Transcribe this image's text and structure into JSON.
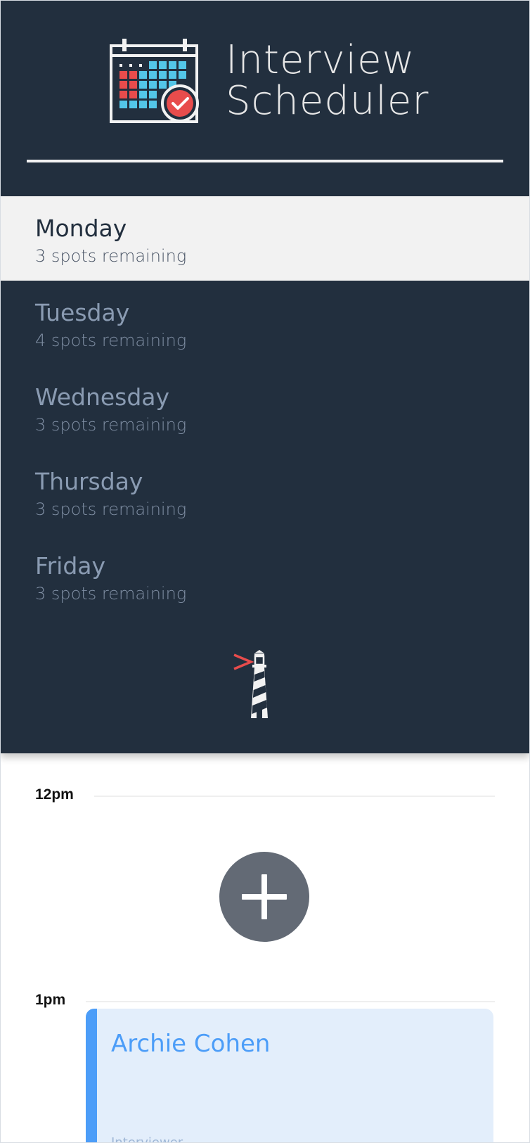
{
  "app": {
    "title_line1": "Interview",
    "title_line2": "Scheduler"
  },
  "icons": {
    "app_logo": "calendar-check-icon",
    "footer_logo": "lighthouse-icon"
  },
  "colors": {
    "sidebar_bg": "#222f3e",
    "selected_day_bg": "#f2f2f2",
    "accent_blue": "#4c9df8",
    "add_button": "#636a75"
  },
  "days": [
    {
      "name": "Monday",
      "spots": "3 spots remaining",
      "selected": true
    },
    {
      "name": "Tuesday",
      "spots": "4 spots remaining",
      "selected": false
    },
    {
      "name": "Wednesday",
      "spots": "3 spots remaining",
      "selected": false
    },
    {
      "name": "Thursday",
      "spots": "3 spots remaining",
      "selected": false
    },
    {
      "name": "Friday",
      "spots": "3 spots remaining",
      "selected": false
    }
  ],
  "schedule": {
    "slots": [
      {
        "time": "12pm",
        "status": "empty"
      },
      {
        "time": "1pm",
        "status": "booked",
        "student": "Archie Cohen",
        "interviewer_label": "Interviewer"
      }
    ]
  }
}
